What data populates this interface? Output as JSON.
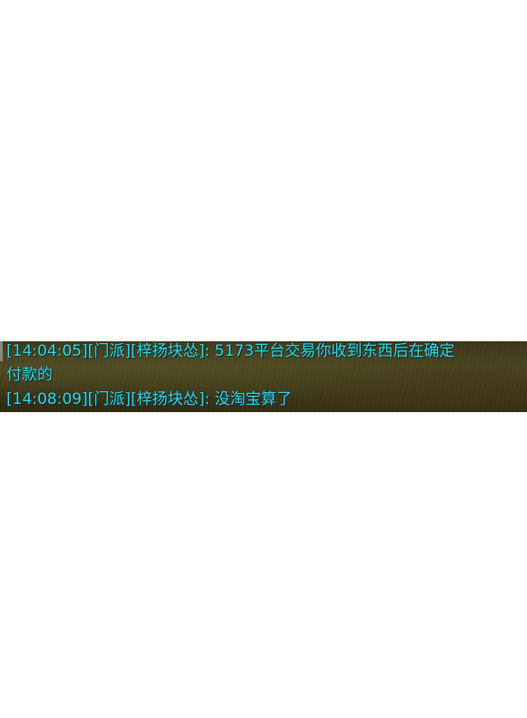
{
  "chat": {
    "messages": [
      {
        "time": "[14:04:05]",
        "channel": "[门派]",
        "sender": "[梓扬块怂]",
        "separator": ":",
        "text_line1": "5173平台交易你收到东西后在确定",
        "text_line2": "付款的"
      },
      {
        "time": "[14:08:09]",
        "channel": "[门派]",
        "sender": "[梓扬块怂]",
        "separator": ":",
        "text_line1": "没淘宝算了"
      }
    ],
    "text_color": "#2fd4e6"
  }
}
